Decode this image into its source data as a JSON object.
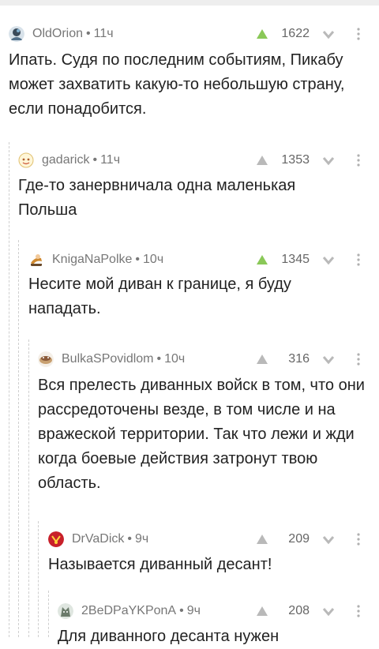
{
  "colors": {
    "upvote_active": "#8ac858",
    "upvote_inactive": "#b9b9b9",
    "downvote": "#b9b9b9",
    "guide": "#cfcfcf"
  },
  "comments": [
    {
      "author": "OldOrion",
      "time": "11ч",
      "score": "1622",
      "upvoted": true,
      "text": "Ипать. Судя по последним событиям, Пикабу может захватить какую-то небольшую страну, если понадобится."
    },
    {
      "author": "gadarick",
      "time": "11ч",
      "score": "1353",
      "upvoted": false,
      "text": "Где-то занервничала одна маленькая Польша"
    },
    {
      "author": "KnigaNaPolke",
      "time": "10ч",
      "score": "1345",
      "upvoted": true,
      "text": "Несите мой диван к границе, я буду нападать."
    },
    {
      "author": "BulkaSPovidlom",
      "time": "10ч",
      "score": "316",
      "upvoted": false,
      "text": "Вся прелесть диванных войск в том, что они рассредоточены везде, в том числе и на вражеской территории. Так что лежи и жди когда боевые действия затронут твою область."
    },
    {
      "author": "DrVaDick",
      "time": "9ч",
      "score": "209",
      "upvoted": false,
      "text": "Называется диванный десант!"
    },
    {
      "author": "2BeDPaYKPonA",
      "time": "9ч",
      "score": "208",
      "upvoted": false,
      "text": "Для диванного десанта нужен"
    }
  ],
  "icons": {
    "upvote": "triangle-up-icon",
    "downvote": "chevron-down-icon",
    "more": "more-vertical-icon"
  }
}
